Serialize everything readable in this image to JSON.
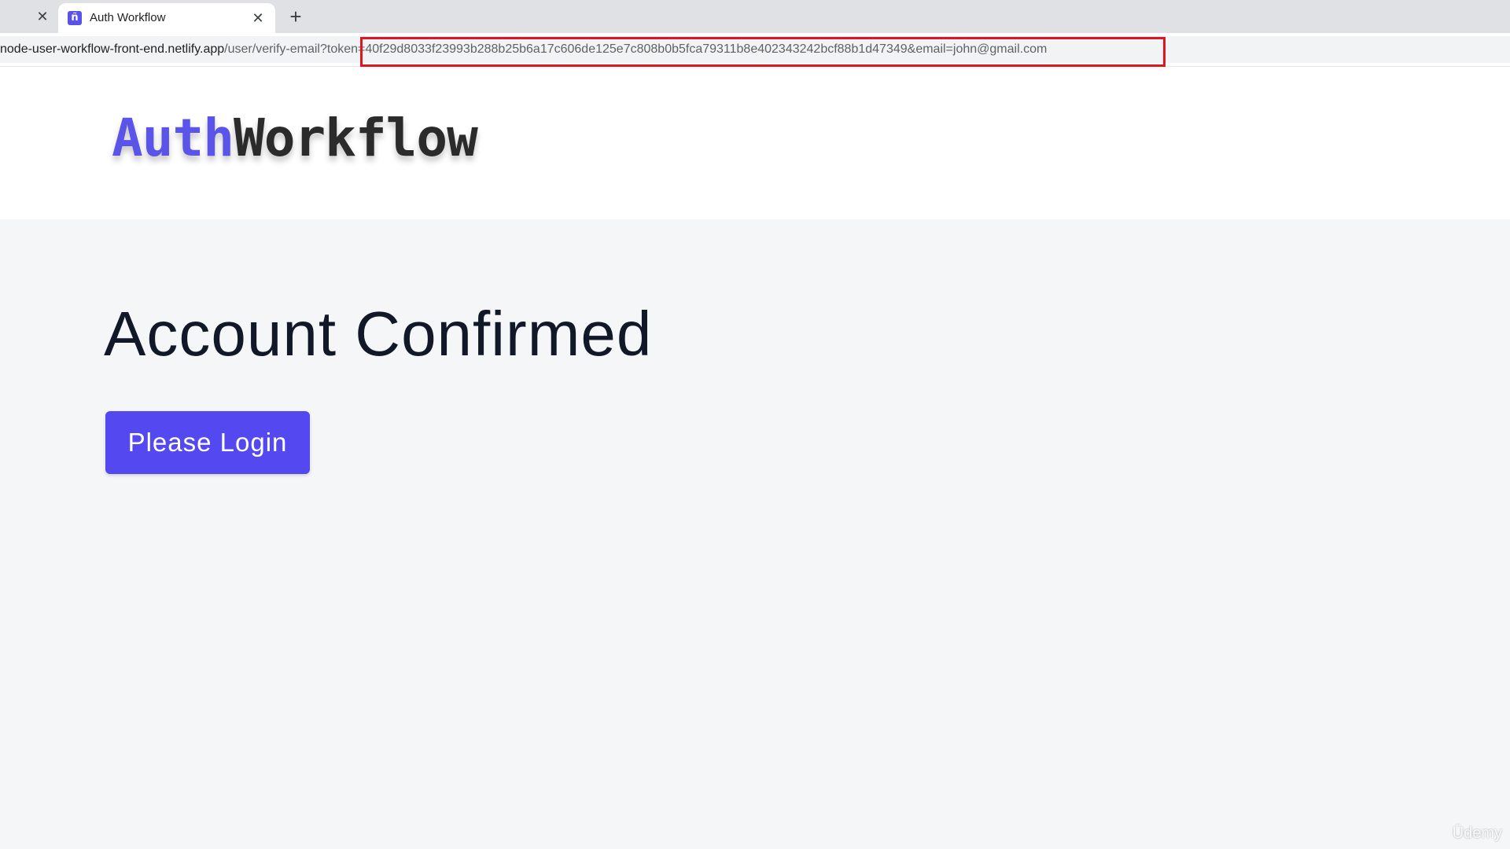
{
  "browser": {
    "prev_tab_close": "✕",
    "active_tab": {
      "favicon": "ñ",
      "title": "Auth Workflow",
      "close": "✕"
    },
    "new_tab": "+",
    "url": {
      "host": "node-user-workflow-front-end.netlify.app",
      "path": "/user/verify-email?",
      "query": "token=40f29d8033f23993b288b25b6a17c606de125e7c808b0b5fca79311b8e402343242bcf88b1d47349&email=john@gmail.com"
    },
    "highlight_color": "#e1141f"
  },
  "navbar": {
    "logo_part1": "Auth",
    "logo_part2": "Workflow"
  },
  "main": {
    "title": "Account Confirmed",
    "login_button": "Please Login"
  },
  "watermark": "Ūdemy",
  "colors": {
    "brand": "#5449f0",
    "text": "#111827",
    "background": "#f5f6f8"
  }
}
